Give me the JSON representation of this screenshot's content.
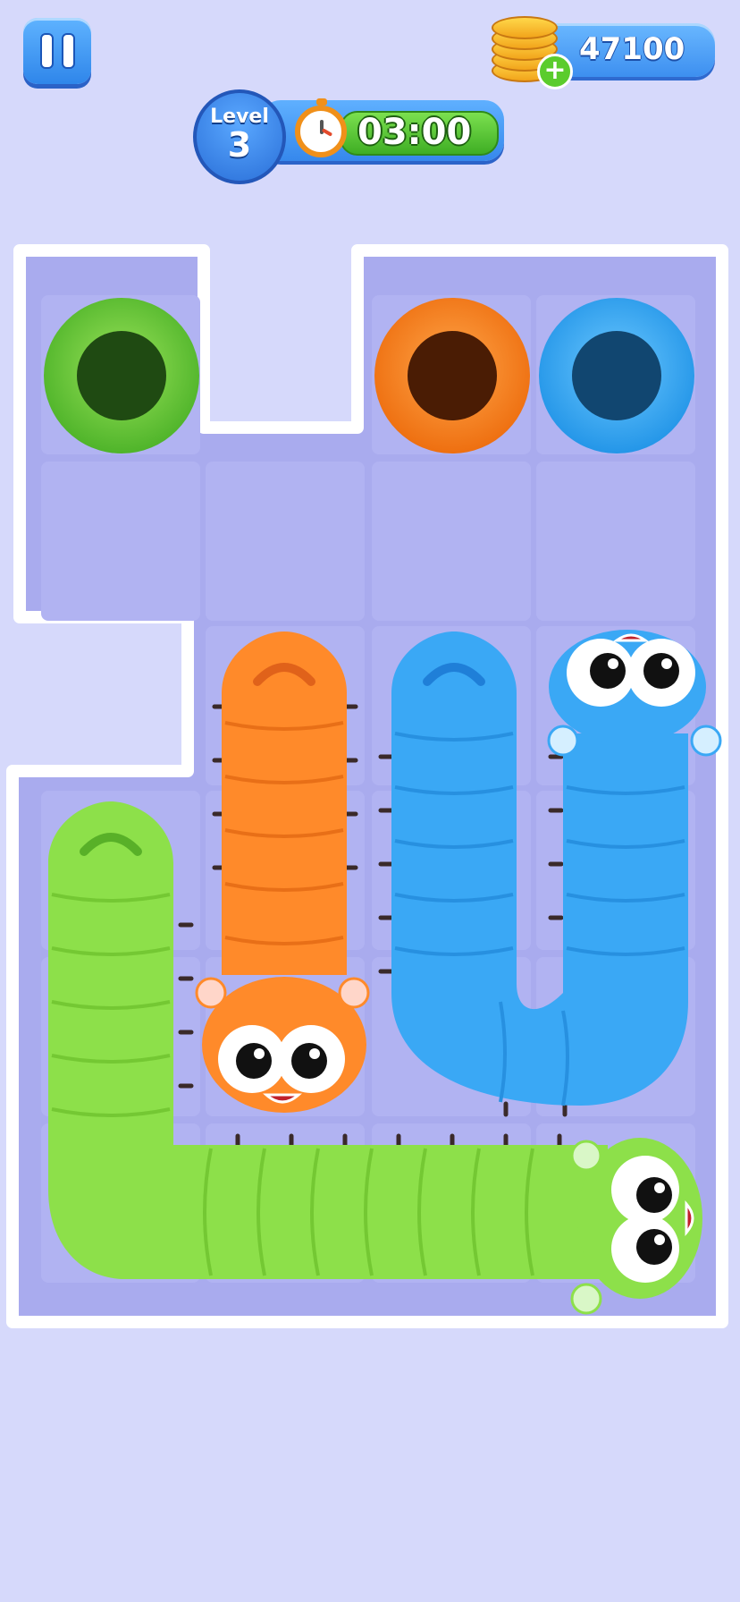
{
  "hud": {
    "coins": "47100",
    "level_label": "Level",
    "level_number": "3",
    "timer": "03:00"
  },
  "icons": {
    "pause": "pause-icon",
    "coins": "coin-stack-icon",
    "add_coins": "plus-icon",
    "timer": "stopwatch-icon"
  },
  "colors": {
    "background": "#d6d9fb",
    "board": "#a9abee",
    "green_worm": "#8de04a",
    "orange_worm": "#ff8a2a",
    "blue_worm": "#3aa8f5"
  },
  "holes": [
    {
      "color": "green"
    },
    {
      "color": "orange"
    },
    {
      "color": "blue"
    }
  ],
  "worms": [
    {
      "color": "orange"
    },
    {
      "color": "blue"
    },
    {
      "color": "green"
    }
  ]
}
